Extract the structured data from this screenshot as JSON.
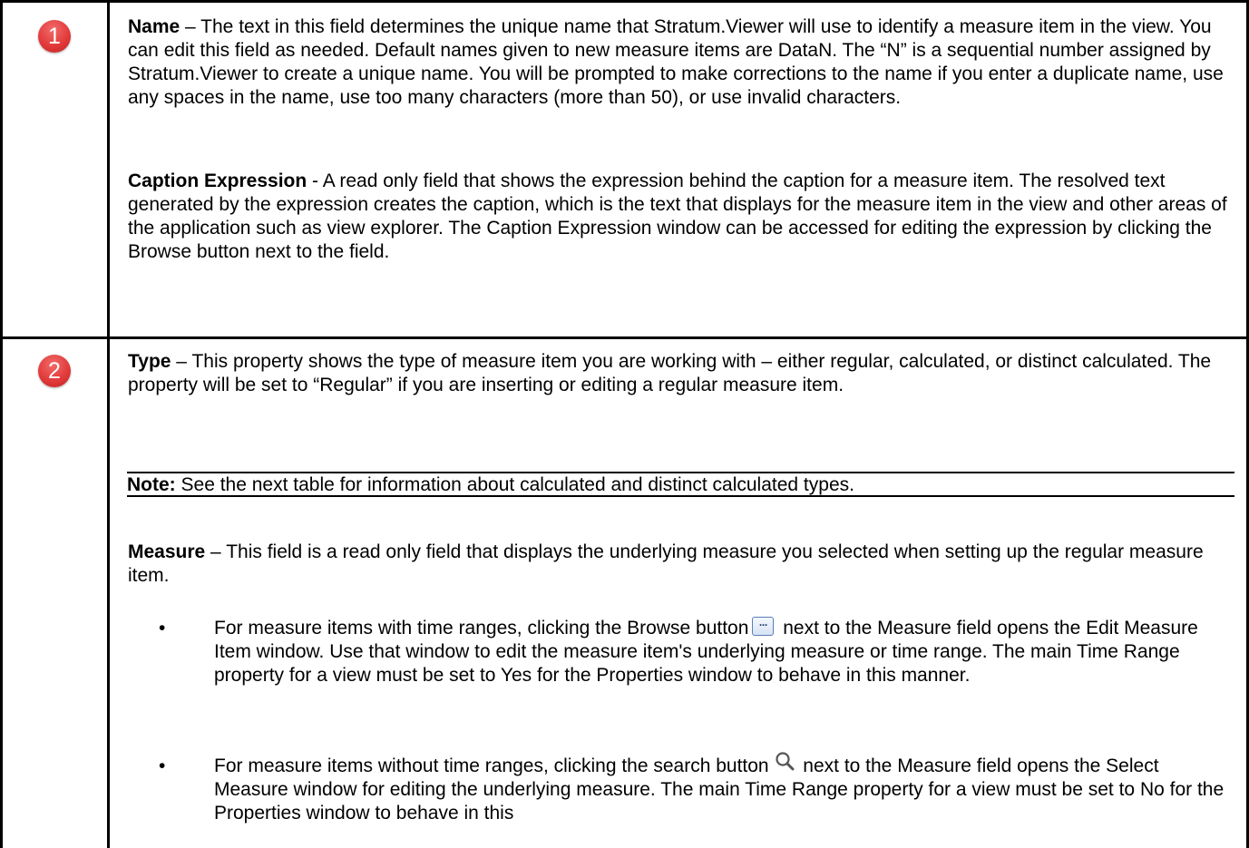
{
  "rows": [
    {
      "number": "1",
      "paragraphs": [
        {
          "term": "Name",
          "text": " – The text in this field determines the unique name that Stratum.Viewer will use to identify a measure item in the view. You can edit this field as needed. Default names given to new measure items are DataN. The “N” is a sequential number assigned by Stratum.Viewer to create a unique name. You will be prompted to make corrections to the name if you enter a duplicate name, use any spaces in the name, use too many characters (more than 50), or use invalid characters."
        },
        {
          "term": "Caption Expression",
          "text": " - A read only field that shows the expression behind the caption for a measure item. The resolved text generated by the expression creates the caption, which is the text that displays for the measure item in the view and other areas of the application such as view explorer. The Caption Expression window can be accessed for editing the expression by clicking the Browse button next to the field."
        }
      ]
    },
    {
      "number": "2",
      "type_para": {
        "term": "Type",
        "text": " – This property shows the type of measure item you are working with – either regular, calculated, or distinct calculated. The property will be set to “Regular” if you are inserting or editing a regular measure item."
      },
      "note": {
        "term": "Note:",
        "text": " See the next table for information about calculated and distinct calculated types."
      },
      "measure_para": {
        "term": "Measure",
        "text": " – This field is a read only field that displays the underlying measure you selected when setting up the regular measure item."
      },
      "bullets": [
        {
          "before": "For measure items with time ranges, clicking the Browse button",
          "icon": "browse-icon",
          "after": " next to the Measure field opens the Edit Measure Item window. Use that window to edit the measure item's underlying measure or time range. The main Time Range property for a view must be set to Yes for the Properties window to behave in this manner."
        },
        {
          "before": "For measure items without time ranges, clicking the search button",
          "icon": "search-icon",
          "after": " next to the Measure field opens the Select Measure window for editing the underlying measure. The main Time Range property for a view must be set to No for the Properties window to behave in this"
        }
      ]
    }
  ],
  "bullet_char": "•",
  "badge_color": "#e23b3b"
}
